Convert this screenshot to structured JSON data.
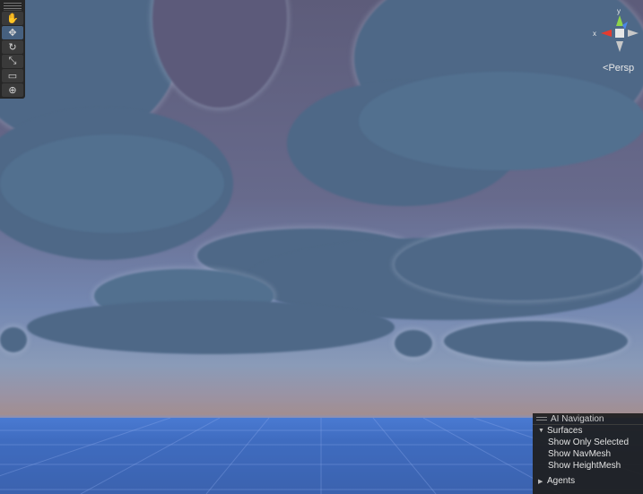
{
  "toolbar": {
    "tools": [
      {
        "icon": "hand-tool-icon",
        "glyph": "✋"
      },
      {
        "icon": "move-tool-icon",
        "glyph": "✥"
      },
      {
        "icon": "rotate-tool-icon",
        "glyph": "↻"
      },
      {
        "icon": "scale-tool-icon",
        "glyph": "⤡"
      },
      {
        "icon": "rect-tool-icon",
        "glyph": "▭"
      },
      {
        "icon": "transform-tool-icon",
        "glyph": "⊕"
      }
    ],
    "active_index": 1
  },
  "gizmo": {
    "y_label": "y",
    "x_label": "x",
    "projection_label": "Persp",
    "colors": {
      "x": "#e53b2f",
      "y": "#8fd44a",
      "z": "#4a86e8"
    }
  },
  "ai_navigation": {
    "title": "AI Navigation",
    "surfaces_label": "Surfaces",
    "options": [
      "Show Only Selected",
      "Show NavMesh",
      "Show HeightMesh"
    ],
    "agents_label": "Agents"
  },
  "colors": {
    "sky_top": "#5d5c7a",
    "ground": "#3f6cc0",
    "panel": "#1e1e1e",
    "active_tool": "#46607f"
  }
}
